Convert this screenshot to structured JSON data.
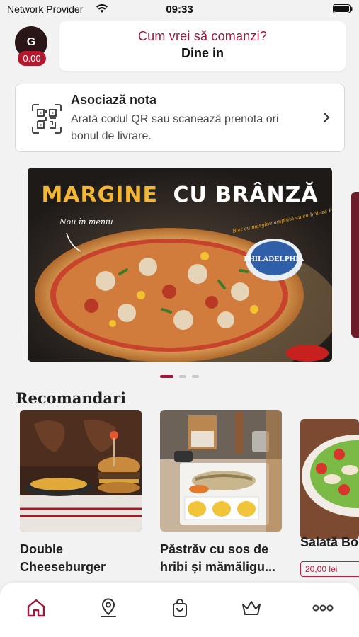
{
  "status_bar": {
    "carrier": "Network Provider",
    "time": "09:33"
  },
  "header": {
    "avatar_initial": "G",
    "balance": "0.00",
    "order_question": "Cum vrei să comanzi?",
    "order_mode": "Dine in"
  },
  "associate": {
    "title": "Asociază nota",
    "description": "Arată codul QR sau scanează prenota ori bonul de livrare.",
    "icon": "qr-scan-icon"
  },
  "banner": {
    "headline_part1": "MARGINE",
    "headline_part2": "CU BRÂNZĂ",
    "note_left": "Nou în meniu",
    "note_right": "Blat cu margine umplută cu cu brânză Philadelphia",
    "brand": "PHILADELPHIA",
    "slide_count": 3,
    "active_slide": 1
  },
  "recommendations": {
    "title": "Recomandari",
    "items": [
      {
        "name": "Double Cheeseburger",
        "price": ""
      },
      {
        "name": "Păstrăv cu sos de hribi și mămăligu...",
        "price": ""
      },
      {
        "name": "Salată Bo",
        "price": "20,00 lei"
      }
    ]
  },
  "tab_bar": {
    "tabs": [
      {
        "icon": "home-icon",
        "active": true
      },
      {
        "icon": "location-pin-icon",
        "active": false
      },
      {
        "icon": "shopping-bag-icon",
        "active": false
      },
      {
        "icon": "crown-icon",
        "active": false
      },
      {
        "icon": "more-icon",
        "active": false
      }
    ]
  },
  "colors": {
    "accent": "#a0173a",
    "badge": "#b3182f",
    "background": "#f2f2f3"
  }
}
